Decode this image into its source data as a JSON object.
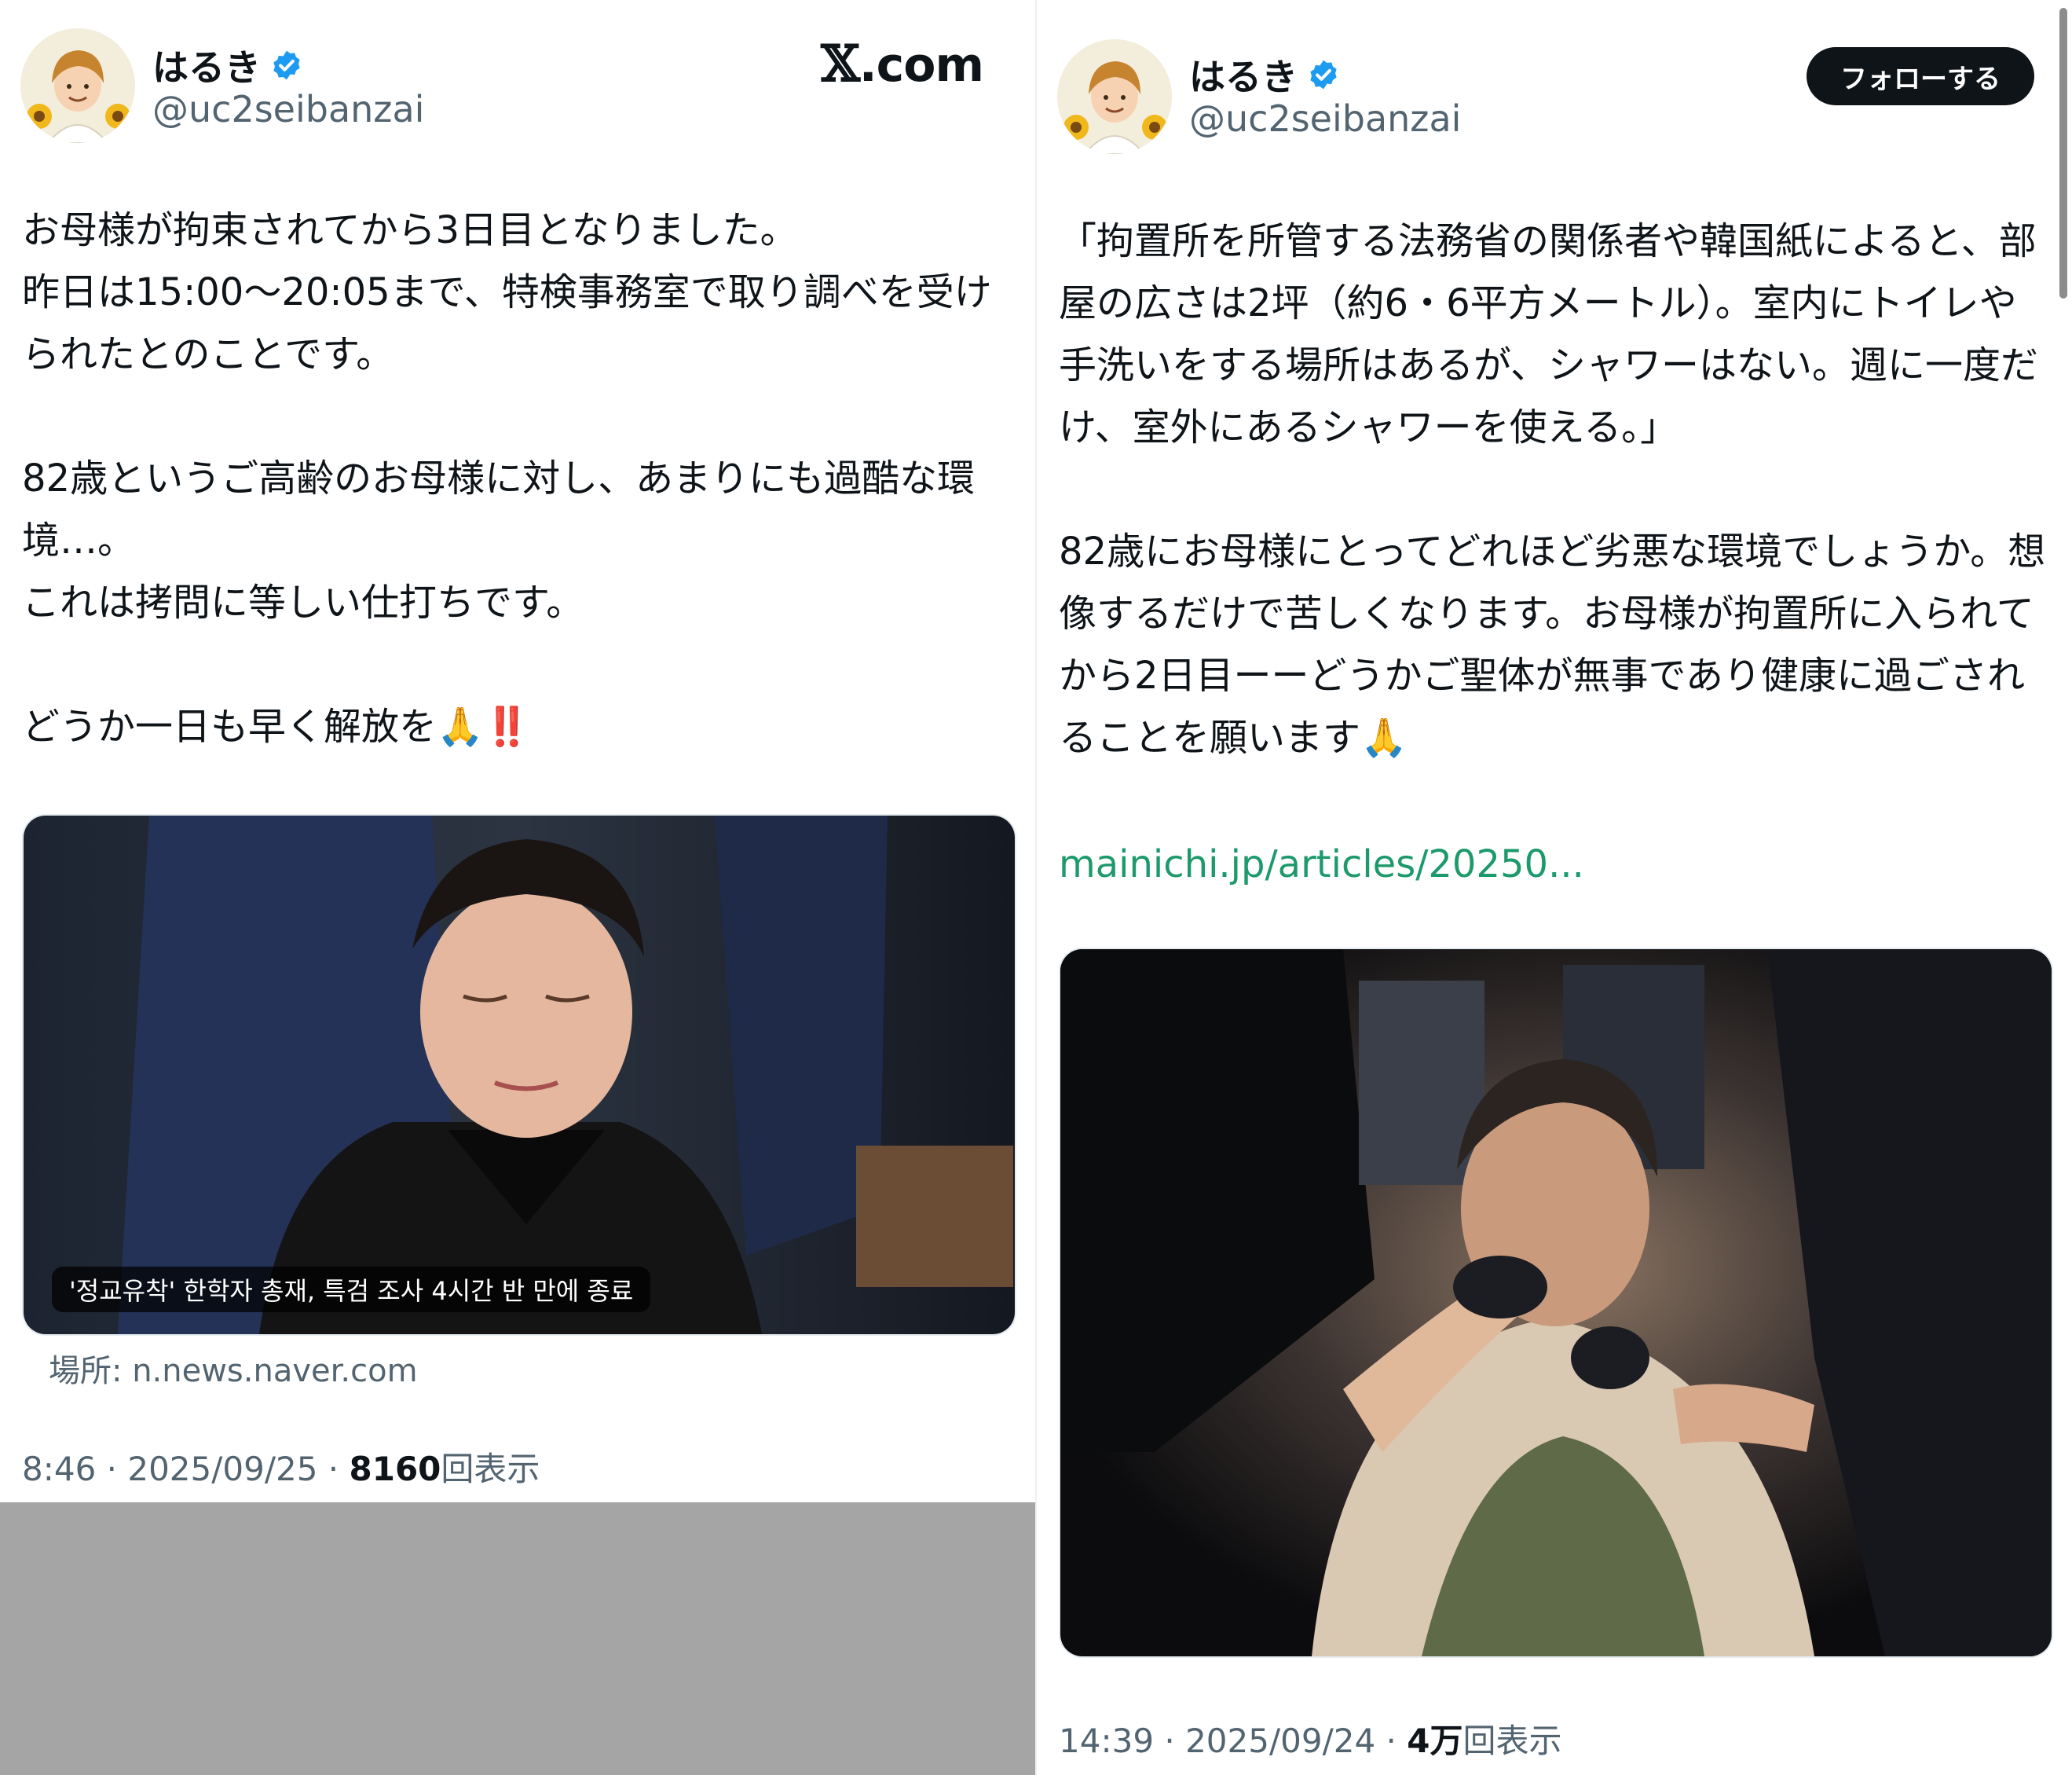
{
  "left_post": {
    "display_name": "はるき",
    "handle": "@uc2seibanzai",
    "site_label": ".com",
    "body": "お母様が拘束されてから3日目となりました。\n昨日は15:00〜20:05まで、特検事務室で取り調べを受けられたとのことです。\n\n82歳というご高齢のお母様に対し、あまりにも過酷な環境…。\nこれは拷問に等しい仕打ちです。\n\nどうか一日も早く解放を🙏‼️",
    "media_caption": "'정교유착' 한학자 총재, 특검 조사 4시간 반 만에 종료",
    "source": "場所: n.news.naver.com",
    "time": "8:46 · 2025/09/25 · ",
    "views_count": "8160",
    "views_label": "回表示"
  },
  "right_post": {
    "display_name": "はるき",
    "handle": "@uc2seibanzai",
    "follow_label": "フォローする",
    "body": "「拘置所を所管する法務省の関係者や韓国紙によると、部屋の広さは2坪（約6・6平方メートル）。室内にトイレや手洗いをする場所はあるが、シャワーはない。週に一度だけ、室外にあるシャワーを使える。」\n\n82歳にお母様にとってどれほど劣悪な環境でしょうか。想像するだけで苦しくなります。お母様が拘置所に入られてから2日目ーーどうかご聖体が無事であり健康に過ごされることを願います🙏",
    "link": "mainichi.jp/articles/20250...",
    "time": "14:39 · 2025/09/24 · ",
    "views_count": "4万",
    "views_label": "回表示"
  },
  "colors": {
    "text": "#0f1419",
    "secondary": "#536471",
    "verified_blue": "#1d9bf0",
    "link_green": "#1d9a6c",
    "gray_block": "#a5a5a5"
  },
  "icons": [
    "verified-badge-icon",
    "x-logo-icon",
    "avatar-illustration"
  ]
}
